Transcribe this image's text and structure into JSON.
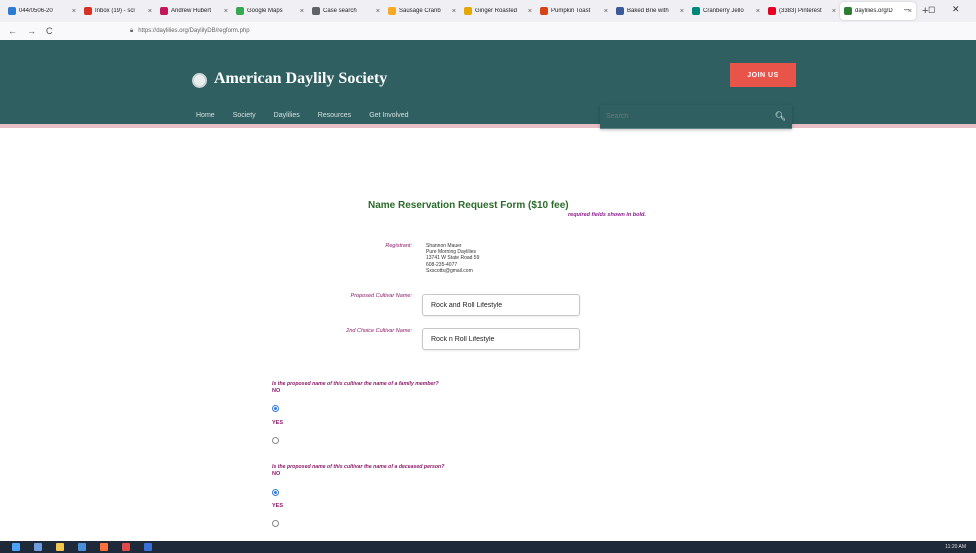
{
  "browser": {
    "tabs": [
      {
        "label": "044/0506-20",
        "color": "#2b7bd0"
      },
      {
        "label": "Inbox (19) - scl",
        "color": "#d93025"
      },
      {
        "label": "Andrew Hubert",
        "color": "#c2185b"
      },
      {
        "label": "Google Maps",
        "color": "#34a853"
      },
      {
        "label": "Case search",
        "color": "#5f6368"
      },
      {
        "label": "Sausage Cranb",
        "color": "#f9a825"
      },
      {
        "label": "Ginger Roasted",
        "color": "#e6a800"
      },
      {
        "label": "Pumpkin Toast",
        "color": "#d84315"
      },
      {
        "label": "Baked Brie with",
        "color": "#3b5998"
      },
      {
        "label": "Cranberry Jello",
        "color": "#00897b"
      },
      {
        "label": "(3383) Pinterest",
        "color": "#e60023"
      },
      {
        "label": "daylilies.org/D",
        "color": "#2e7d32"
      }
    ],
    "new_tab": "+",
    "url": "https://daylilies.org/DaylilyDB/regform.php",
    "nav_back": "←",
    "nav_forward": "→",
    "nav_reload": "C",
    "min": "–",
    "max": "◻",
    "close": "✕"
  },
  "site": {
    "title": "American Daylily Society",
    "join_label": "JOIN US",
    "nav": [
      "Home",
      "Society",
      "Daylilies",
      "Resources",
      "Get Involved"
    ],
    "search_placeholder": "Search",
    "search_icon": "search-icon",
    "header_color": "#2f5f61",
    "accent": "#e8534a"
  },
  "form": {
    "title": "Name Reservation Request Form ($10 fee)",
    "required_note": "required fields shown in bold.",
    "registrant_label": "Registrant:",
    "registrant_lines": [
      "Shannon Mauer",
      "Pure Morning Daylilies",
      "13741 W State Road 59",
      "608-235-4077",
      "Sxscotts@gmail.com"
    ],
    "proposed_label": "Proposed Cultivar Name:",
    "proposed_value": "Rock and Roll Lifestyle",
    "second_label": "2nd Choice Cultivar Name:",
    "second_value": "Rock n Roll Lifestyle",
    "q1": "Is the proposed name of this cultivar the name of a family member?",
    "q2": "Is the proposed name of this cultivar the name of a deceased person?",
    "no_label": "NO",
    "yes_label": "YES"
  },
  "taskbar": {
    "time": "11:20 AM"
  }
}
